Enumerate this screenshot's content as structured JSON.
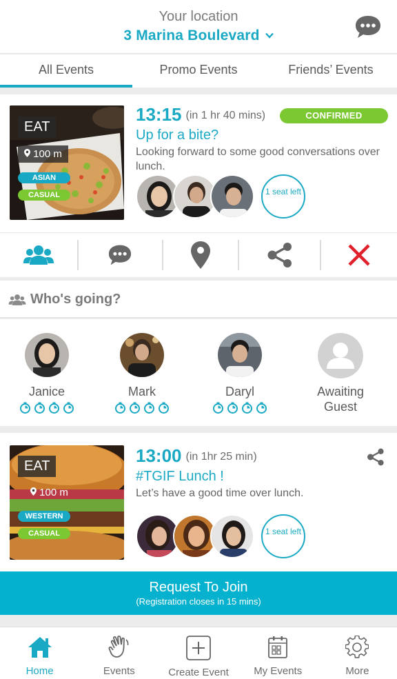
{
  "header": {
    "location_label": "Your location",
    "location_value": "3 Marina Boulevard"
  },
  "tabs": [
    {
      "label": "All Events",
      "active": true
    },
    {
      "label": "Promo Events",
      "active": false
    },
    {
      "label": "Friends’ Events",
      "active": false
    }
  ],
  "event1": {
    "category": "EAT",
    "distance": "100 m",
    "tags": [
      "ASIAN",
      "CASUAL"
    ],
    "time": "13:15",
    "time_relative": "(in 1 hr 40 mins)",
    "status": "CONFIRMED",
    "title": "Up for a bite?",
    "description": "Looking forward to some good conversations over lunch.",
    "seat_label": "1 seat left"
  },
  "actions": [
    "group-icon",
    "chat-icon",
    "location-pin-icon",
    "share-icon",
    "close-icon"
  ],
  "who_going": {
    "title": "Who's going?",
    "people": [
      {
        "name": "Janice"
      },
      {
        "name": "Mark"
      },
      {
        "name": "Daryl"
      },
      {
        "name": "Awaiting Guest"
      }
    ]
  },
  "event2": {
    "category": "EAT",
    "distance": "100 m",
    "tags": [
      "WESTERN",
      "CASUAL"
    ],
    "time": "13:00",
    "time_relative": "(in 1hr 25 min)",
    "title": "#TGIF Lunch !",
    "description": "Let’s have a good time over lunch.",
    "seat_label": "1 seat left"
  },
  "request": {
    "label": "Request To Join",
    "sublabel": "(Registration closes in 15 mins)"
  },
  "nav": [
    {
      "label": "Home",
      "icon": "home-icon",
      "active": true
    },
    {
      "label": "Events",
      "icon": "wave-hand-icon",
      "active": false
    },
    {
      "label": "Create Event",
      "icon": "plus-box-icon",
      "active": false
    },
    {
      "label": "My Events",
      "icon": "calendar-icon",
      "active": false
    },
    {
      "label": "More",
      "icon": "gear-icon",
      "active": false
    }
  ],
  "colors": {
    "accent": "#1aa9c4",
    "confirmed": "#7cc832",
    "cancel": "#e0202a",
    "request_bg": "#04b1cf"
  }
}
